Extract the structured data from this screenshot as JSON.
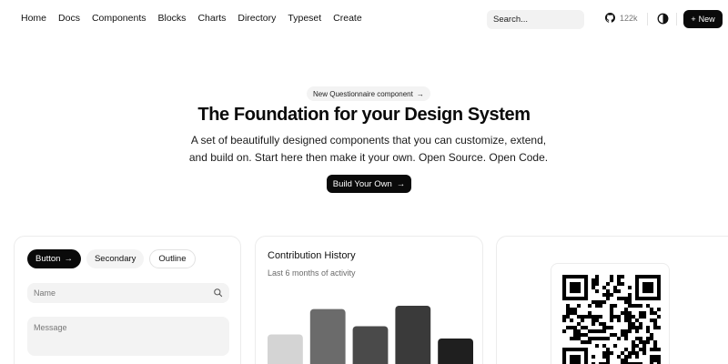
{
  "nav": {
    "links": [
      "Home",
      "Docs",
      "Components",
      "Blocks",
      "Charts",
      "Directory",
      "Typeset",
      "Create"
    ],
    "search_placeholder": "Search...",
    "github_stars": "122k",
    "new_label": "New"
  },
  "hero": {
    "badge": "New Questionnaire component",
    "title": "The Foundation for your Design System",
    "subtitle_line1": "A set of beautifully designed components that you can customize, extend,",
    "subtitle_line2": "and build on. Start here then make it your own. Open Source. Open Code.",
    "cta": "Build Your Own"
  },
  "card_buttons": {
    "primary": "Button",
    "secondary": "Secondary",
    "outline": "Outline",
    "name_placeholder": "Name",
    "message_placeholder": "Message"
  },
  "card_chart": {
    "title": "Contribution History",
    "subtitle": "Last 6 months of activity"
  },
  "chart_data": {
    "type": "bar",
    "categories": [
      "",
      "",
      "",
      "",
      ""
    ],
    "values": [
      45,
      76,
      55,
      80,
      40
    ],
    "colors": [
      "#d4d4d4",
      "#6b6b6b",
      "#4a4a4a",
      "#3a3a3a",
      "#1f1f1f"
    ],
    "ylim": [
      0,
      100
    ],
    "grid": false
  },
  "colors": {
    "primary": "#0a0a0a",
    "muted_bg": "#f3f3f3",
    "border": "#ececec"
  }
}
